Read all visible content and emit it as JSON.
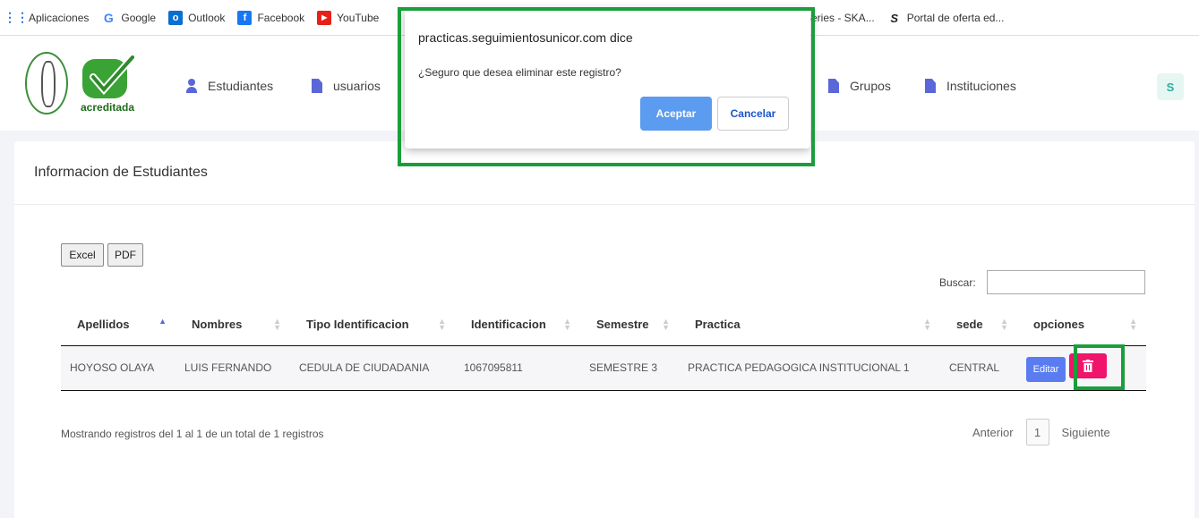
{
  "bookmarks": {
    "items": [
      {
        "label": "Aplicaciones",
        "icon": "apps-grid-icon"
      },
      {
        "label": "Google",
        "icon": "google-icon"
      },
      {
        "label": "Outlook",
        "icon": "outlook-icon"
      },
      {
        "label": "Facebook",
        "icon": "facebook-icon"
      },
      {
        "label": "YouTube",
        "icon": "youtube-icon"
      }
    ],
    "right_items": [
      {
        "label": "Series - SKA..."
      },
      {
        "label": "Portal de oferta ed..."
      }
    ]
  },
  "nav": {
    "logo_text": "acreditada",
    "items": [
      {
        "label": "Estudiantes",
        "icon": "user-icon"
      },
      {
        "label": "usuarios",
        "icon": "document-icon"
      },
      {
        "label": "Grupos",
        "icon": "document-icon"
      },
      {
        "label": "Instituciones",
        "icon": "document-icon"
      }
    ],
    "avatar_initial": "S"
  },
  "card": {
    "title": "Informacion de Estudiantes",
    "export_buttons": [
      "Excel",
      "PDF"
    ],
    "search_label": "Buscar:",
    "search_value": "",
    "columns": [
      "Apellidos",
      "Nombres",
      "Tipo Identificacion",
      "Identificacion",
      "Semestre",
      "Practica",
      "sede",
      "opciones"
    ],
    "rows": [
      {
        "apellidos": "HOYOSO OLAYA",
        "nombres": "LUIS FERNANDO",
        "tipo": "CEDULA DE CIUDADANIA",
        "identificacion": "1067095811",
        "semestre": "SEMESTRE 3",
        "practica": "PRACTICA PEDAGOGICA INSTITUCIONAL 1",
        "sede": "CENTRAL",
        "edit_label": "Editar"
      }
    ],
    "footer_info": "Mostrando registros del 1 al 1 de un total de 1 registros",
    "pager": {
      "prev": "Anterior",
      "page": "1",
      "next": "Siguiente"
    }
  },
  "dialog": {
    "title": "practicas.seguimientosunicor.com dice",
    "message": "¿Seguro que desea eliminar este registro?",
    "ok_label": "Aceptar",
    "cancel_label": "Cancelar"
  },
  "colors": {
    "accent": "#5a67d8",
    "delete": "#f0146a",
    "highlight": "#1a9e3c",
    "ok_button": "#5b9bf0"
  }
}
